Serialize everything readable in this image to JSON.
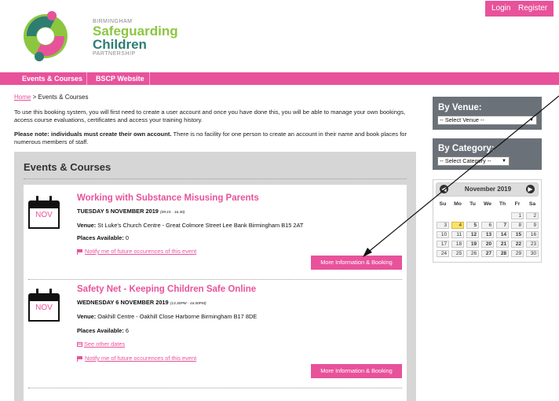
{
  "header": {
    "logo": {
      "small_top": "BIRMINGHAM",
      "line1": "Safeguarding",
      "line2": "Children",
      "small_bottom": "PARTNERSHIP"
    },
    "login_label": "Login",
    "register_label": "Register"
  },
  "nav": {
    "items": [
      {
        "label": "Events & Courses"
      },
      {
        "label": "BSCP Website"
      }
    ]
  },
  "breadcrumb": {
    "home": "Home",
    "separator": " > ",
    "current": "Events & Courses"
  },
  "intro_text": "To use this booking system, you will first need to create a user account and once you have done this, you will be able to manage your own bookings, access course evaluations, certificates and access your training history.",
  "note": {
    "label": "Please note:",
    "bold_text": "individuals must create their own account.",
    "rest": "There is no facility for one person to create an account in their name and book places for numerous members of staff."
  },
  "events_panel": {
    "title": "Events & Courses",
    "events": [
      {
        "month": "NOV",
        "title": "Working with Substance Misusing Parents",
        "date": "TUESDAY 5 NOVEMBER 2019",
        "time": "(09.15 - 16.30)",
        "venue_label": "Venue:",
        "venue": "St Luke's Church Centre - Great Colmore Street Lee Bank Birmingham B15 2AT",
        "places_label": "Places Available:",
        "places": "0",
        "notify_link": "Notify me of future occurences of this event",
        "book_label": "More Information & Booking"
      },
      {
        "month": "NOV",
        "title": "Safety Net - Keeping Children Safe Online",
        "date": "WEDNESDAY 6 NOVEMBER 2019",
        "time": "(13.30PM - 16.00PM)",
        "venue_label": "Venue:",
        "venue": "Oakhill Centre - Oakhill Close Harborne Birmingham B17 8DE",
        "places_label": "Places Available:",
        "places": "6",
        "other_dates_link": "See other dates",
        "notify_link": "Notify me of future occurences of this event",
        "book_label": "More Information & Booking"
      }
    ]
  },
  "sidebar": {
    "venue": {
      "title": "By Venue:",
      "selected": "-- Select Venue --"
    },
    "category": {
      "title": "By Category:",
      "selected": "-- Select Category --"
    },
    "calendar": {
      "title": "November 2019",
      "prev": "◀",
      "next": "▶",
      "weekdays": [
        "Su",
        "Mo",
        "Tu",
        "We",
        "Th",
        "Fr",
        "Sa"
      ],
      "weeks": [
        [
          "",
          "",
          "",
          "",
          "",
          "1",
          "2"
        ],
        [
          "3",
          "4",
          "5",
          "6",
          "7",
          "8",
          "9"
        ],
        [
          "10",
          "11",
          "12",
          "13",
          "14",
          "15",
          "16"
        ],
        [
          "17",
          "18",
          "19",
          "20",
          "21",
          "22",
          "23"
        ],
        [
          "24",
          "25",
          "26",
          "27",
          "28",
          "29",
          "30"
        ]
      ],
      "highlighted_day": "4",
      "bold_days": [
        "5",
        "7",
        "12",
        "13",
        "14",
        "15",
        "19",
        "20",
        "21",
        "22",
        "27",
        "28"
      ]
    }
  },
  "colors": {
    "accent": "#e8529b",
    "sidebar_box": "#6b7178",
    "panel_bg": "#d6d6d6",
    "logo_green": "#8cc63f",
    "logo_teal": "#2e7d73",
    "today": "#fbe36a"
  }
}
